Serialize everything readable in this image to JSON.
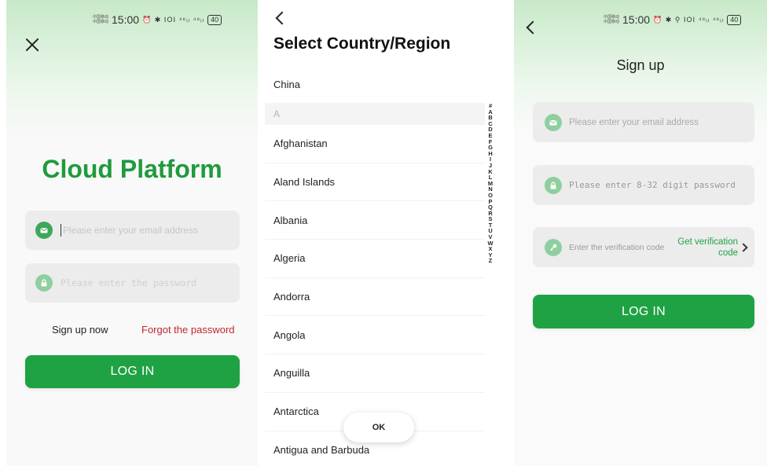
{
  "login": {
    "status": {
      "carrier": "中国移动\n中国移动",
      "time": "15:00",
      "icons": "⏰ ✱ ⅠOⅠ ⁴⁶ᵢₗ ⁴⁶ᵢₗ",
      "battery": "40"
    },
    "icons": {
      "close": "close-icon",
      "email": "envelope-icon",
      "password": "lock-icon"
    },
    "brand": "Cloud Platform",
    "email_placeholder": "Please enter your email address",
    "password_placeholder": "Please enter the password",
    "sign_up_link": "Sign up now",
    "forgot_link": "Forgot the password",
    "login_button": "LOG IN"
  },
  "country": {
    "icons": {
      "back": "back-chevron-icon"
    },
    "title": "Select Country/Region",
    "top_item": "China",
    "section_header": "A",
    "countries": [
      "Afghanistan",
      "Aland Islands",
      "Albania",
      "Algeria",
      "Andorra",
      "Angola",
      "Anguilla",
      "Antarctica",
      "Antigua and Barbuda"
    ],
    "index_letters": [
      "#",
      "A",
      "B",
      "C",
      "D",
      "E",
      "F",
      "G",
      "H",
      "I",
      "J",
      "K",
      "L",
      "M",
      "N",
      "O",
      "P",
      "Q",
      "R",
      "S",
      "T",
      "U",
      "V",
      "W",
      "X",
      "Y",
      "Z"
    ],
    "ok_button": "OK"
  },
  "signup": {
    "status": {
      "carrier": "中国移动\n中国移动",
      "time": "15:00",
      "icons": "⏰ ✱ ⚲ ⅠOⅠ ⁴⁶ᵢₗ ⁴⁶ᵢₗ",
      "battery": "40"
    },
    "icons": {
      "back": "back-chevron-icon",
      "email": "envelope-icon",
      "password": "lock-icon",
      "code": "key-icon"
    },
    "title": "Sign up",
    "email_placeholder": "Please enter your email address",
    "password_placeholder": "Please enter 8-32 digit password",
    "code_placeholder": "Enter the verification code",
    "get_code_line1": "Get verification",
    "get_code_line2": "code",
    "login_button": "LOG IN"
  },
  "colors": {
    "accent": "#1fa244",
    "brand_text": "#1f9a3c",
    "forgot_link": "#c0282f",
    "field_bg": "#ececec"
  }
}
